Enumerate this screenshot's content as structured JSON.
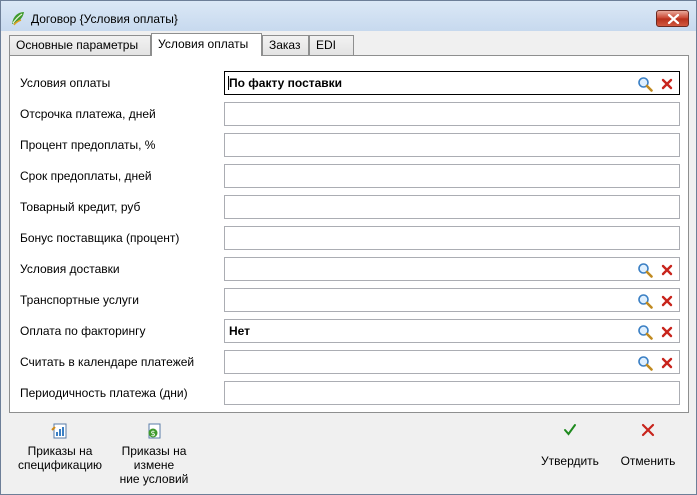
{
  "window": {
    "title": "Договор {Условия оплаты}"
  },
  "tabs": [
    {
      "label": "Основные параметры"
    },
    {
      "label": "Условия оплаты"
    },
    {
      "label": "Заказ"
    },
    {
      "label": "EDI"
    }
  ],
  "fields": [
    {
      "label": "Условия оплаты",
      "value": "По факту поставки",
      "lookup": true
    },
    {
      "label": "Отсрочка платежа, дней",
      "value": "",
      "lookup": false
    },
    {
      "label": "Процент предоплаты, %",
      "value": "",
      "lookup": false
    },
    {
      "label": "Срок предоплаты, дней",
      "value": "",
      "lookup": false
    },
    {
      "label": "Товарный кредит, руб",
      "value": "",
      "lookup": false
    },
    {
      "label": "Бонус поставщика (процент)",
      "value": "",
      "lookup": false
    },
    {
      "label": "Условия доставки",
      "value": "",
      "lookup": true
    },
    {
      "label": "Транспортные услуги",
      "value": "",
      "lookup": true
    },
    {
      "label": "Оплата по факторингу",
      "value": "Нет",
      "lookup": true
    },
    {
      "label": "Считать в календаре платежей",
      "value": "",
      "lookup": true
    },
    {
      "label": "Периодичность платежа (дни)",
      "value": "",
      "lookup": false
    }
  ],
  "toolbar": {
    "orders_spec_line1": "Приказы на",
    "orders_spec_line2": "спецификацию",
    "orders_terms_line1": "Приказы на",
    "orders_terms_line2": "измене",
    "orders_terms_line3": "ние условий",
    "confirm_label": "Утвердить",
    "cancel_label": "Отменить"
  },
  "colors": {
    "confirm_check": "#1e8a1e",
    "cancel_cross": "#c8241c",
    "clear_icon": "#c8241c",
    "search_icon": "#3a7fc4"
  },
  "icons": {
    "app": "app-leaf-icon",
    "window_close": "window-close-icon",
    "lookup": "search-icon",
    "clear": "clear-icon",
    "orders_spec": "document-chart-icon",
    "orders_terms": "document-money-icon",
    "confirm": "checkmark-icon",
    "cancel": "cross-icon"
  }
}
